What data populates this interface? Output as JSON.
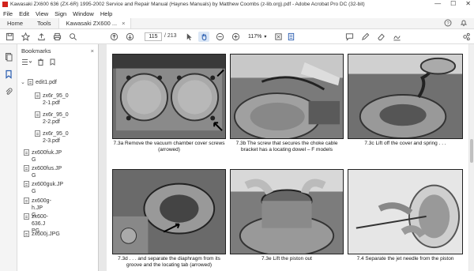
{
  "window": {
    "title": "Kawasaki ZX600 636 (ZX-6R) 1995-2002 Service and Repair Manual (Haynes Manuals) by Matthew Coombs (z-lib.org).pdf - Adobe Acrobat Pro DC (32-bit)",
    "minimize": "—",
    "maximize": "☐",
    "close": "✕"
  },
  "menu": [
    "File",
    "Edit",
    "View",
    "Sign",
    "Window",
    "Help"
  ],
  "tabs": {
    "home": "Home",
    "tools": "Tools",
    "document": "Kawasaki ZX600 ...",
    "close": "×"
  },
  "toolbar": {
    "current_page": "115",
    "page_count": "/ 213",
    "zoom": "117%"
  },
  "bookmarks": {
    "title": "Bookmarks",
    "close": "×",
    "items": [
      {
        "label": "edit1.pdf",
        "expander": "⌄"
      },
      {
        "label": "zx6r_95_0\n2-1.pdf"
      },
      {
        "label": "zx6r_95_0\n2-2.pdf"
      },
      {
        "label": "zx6r_95_0\n2-3.pdf"
      },
      {
        "label": "zx600fuk.JP\nG"
      },
      {
        "label": "zx600fus.JP\nG"
      },
      {
        "label": "zx600guk.JP\nG"
      },
      {
        "label": "zx600g-h.JP\nG"
      },
      {
        "label": "zx600-636.J\nPG"
      },
      {
        "label": "zx600j.JPG"
      }
    ]
  },
  "captions": {
    "c1": "7.3a  Remove the vacuum chamber cover screws (arrowed)",
    "c2": "7.3b  The screw that secures the choke cable bracket has a locating dowel – F models",
    "c3": "7.3c  Lift off the cover and spring . . .",
    "c4": "7.3d  . . . and separate the diaphragm from its groove and the locating tab (arrowed)",
    "c5": "7.3e  Lift the piston out",
    "c6": "7.4  Separate the jet needle from the piston"
  },
  "colors": {
    "accent": "#d2231c",
    "hand_tool_bg": "#dbe7f6"
  }
}
